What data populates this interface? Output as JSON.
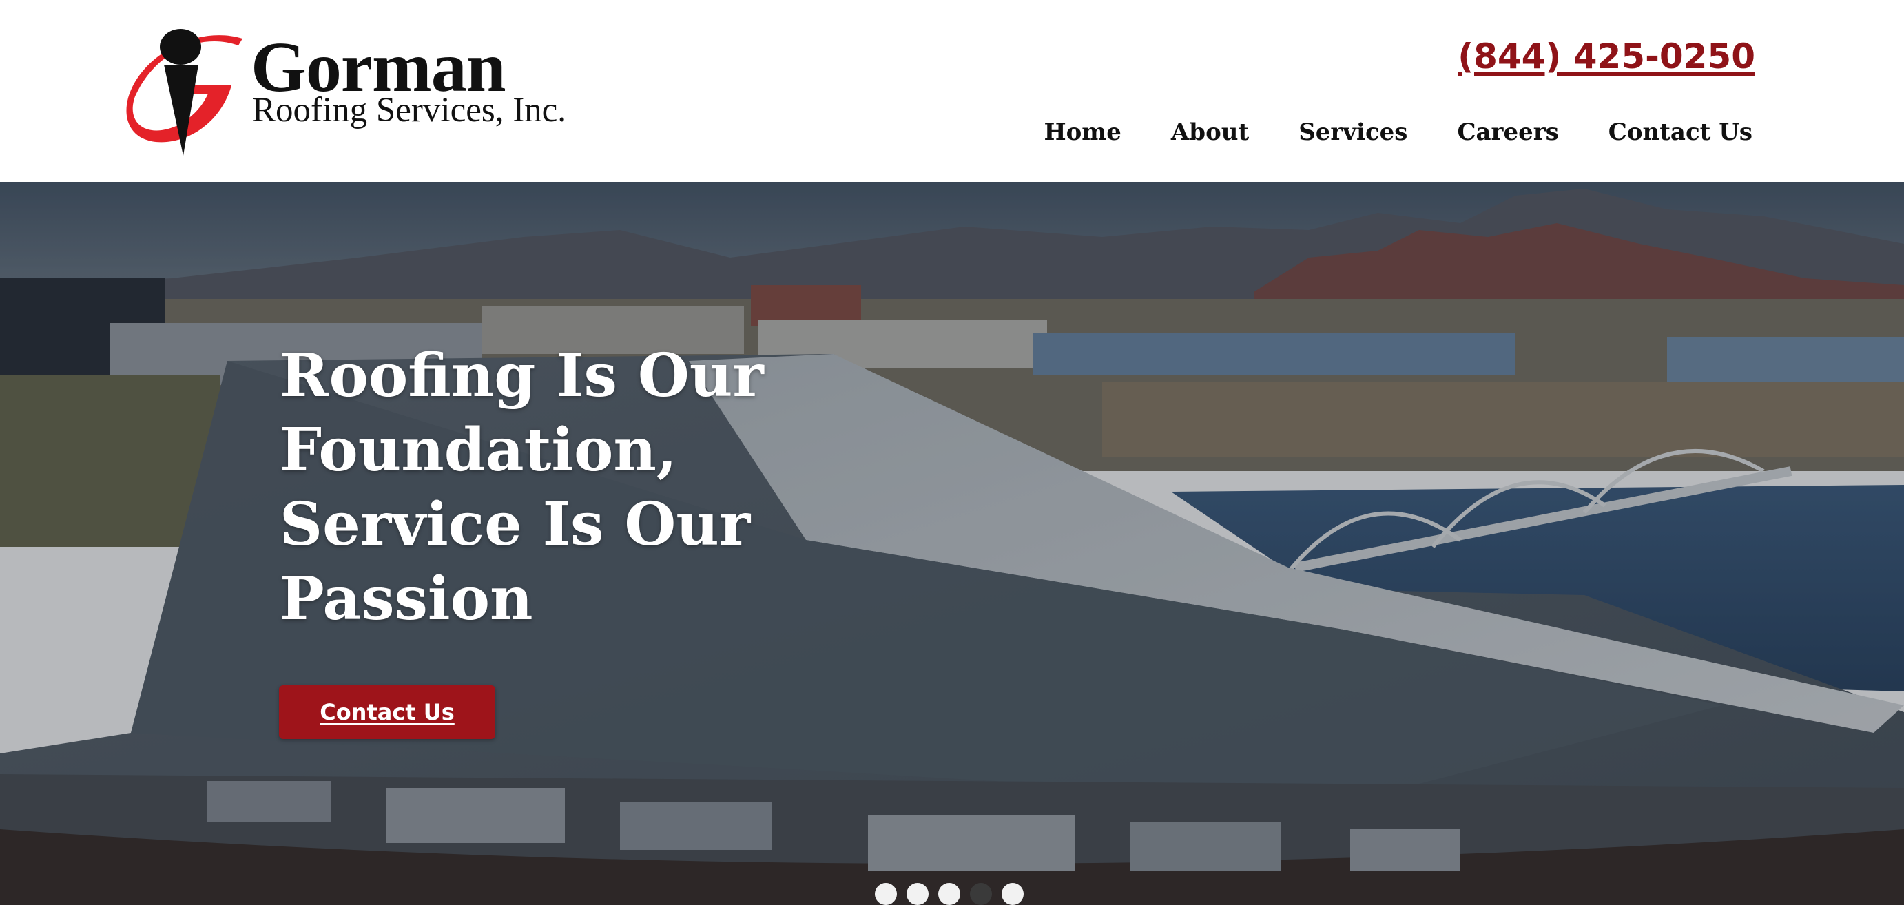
{
  "header": {
    "logo": {
      "name": "Gorman",
      "subtitle": "Roofing Services, Inc.",
      "mark_colors": {
        "red": "#e42229",
        "black": "#111111"
      }
    },
    "phone": "(844) 425-0250",
    "nav": [
      {
        "label": "Home"
      },
      {
        "label": "About"
      },
      {
        "label": "Services"
      },
      {
        "label": "Careers"
      },
      {
        "label": "Contact Us"
      }
    ]
  },
  "hero": {
    "title": "Roofing Is Our Foundation, Service Is Our Passion",
    "cta_label": "Contact Us",
    "slides": {
      "count": 5,
      "active_index": 3
    }
  },
  "colors": {
    "accent": "#9e141a",
    "phone": "#8f1318",
    "text": "#111111"
  }
}
